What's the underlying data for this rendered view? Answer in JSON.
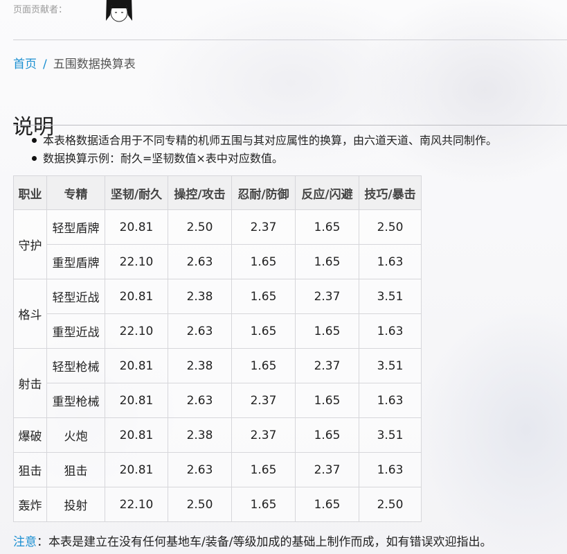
{
  "contributor": {
    "label": "页面贡献者："
  },
  "breadcrumb": {
    "home": "首页",
    "separator": "/",
    "current": "五围数据换算表"
  },
  "section": {
    "title": "说明"
  },
  "notes": [
    "本表格数据适合用于不同专精的机师五围与其对应属性的换算，由六道天道、南风共同制作。",
    "数据换算示例：耐久=坚韧数值×表中对应数值。"
  ],
  "table": {
    "headers": [
      "职业",
      "专精",
      "坚韧/耐久",
      "操控/攻击",
      "忍耐/防御",
      "反应/闪避",
      "技巧/暴击"
    ],
    "groups": [
      {
        "class": "守护",
        "rows": [
          {
            "spec": "轻型盾牌",
            "values": [
              "20.81",
              "2.50",
              "2.37",
              "1.65",
              "2.50"
            ]
          },
          {
            "spec": "重型盾牌",
            "values": [
              "22.10",
              "2.63",
              "1.65",
              "1.65",
              "1.63"
            ]
          }
        ]
      },
      {
        "class": "格斗",
        "rows": [
          {
            "spec": "轻型近战",
            "values": [
              "20.81",
              "2.38",
              "1.65",
              "2.37",
              "3.51"
            ]
          },
          {
            "spec": "重型近战",
            "values": [
              "22.10",
              "2.63",
              "1.65",
              "1.65",
              "1.63"
            ]
          }
        ]
      },
      {
        "class": "射击",
        "rows": [
          {
            "spec": "轻型枪械",
            "values": [
              "20.81",
              "2.38",
              "1.65",
              "2.37",
              "3.51"
            ]
          },
          {
            "spec": "重型枪械",
            "values": [
              "20.81",
              "2.63",
              "2.37",
              "1.65",
              "1.63"
            ]
          }
        ]
      },
      {
        "class": "爆破",
        "rows": [
          {
            "spec": "火炮",
            "values": [
              "20.81",
              "2.38",
              "2.37",
              "1.65",
              "3.51"
            ]
          }
        ]
      },
      {
        "class": "狙击",
        "rows": [
          {
            "spec": "狙击",
            "values": [
              "20.81",
              "2.63",
              "1.65",
              "2.37",
              "1.63"
            ]
          }
        ]
      },
      {
        "class": "轰炸",
        "rows": [
          {
            "spec": "投射",
            "values": [
              "22.10",
              "2.50",
              "1.65",
              "1.65",
              "2.50"
            ]
          }
        ]
      }
    ]
  },
  "footer": {
    "label": "注意",
    "text": "：本表是建立在没有任何基地车/装备/等级加成的基础上制作而成，如有错误欢迎指出。"
  },
  "colors": {
    "link": "#1a8fd1",
    "border": "#d6d6da",
    "header_bg": "#eeeef0"
  },
  "icons": {
    "contributor_avatar": "avatar-icon"
  }
}
